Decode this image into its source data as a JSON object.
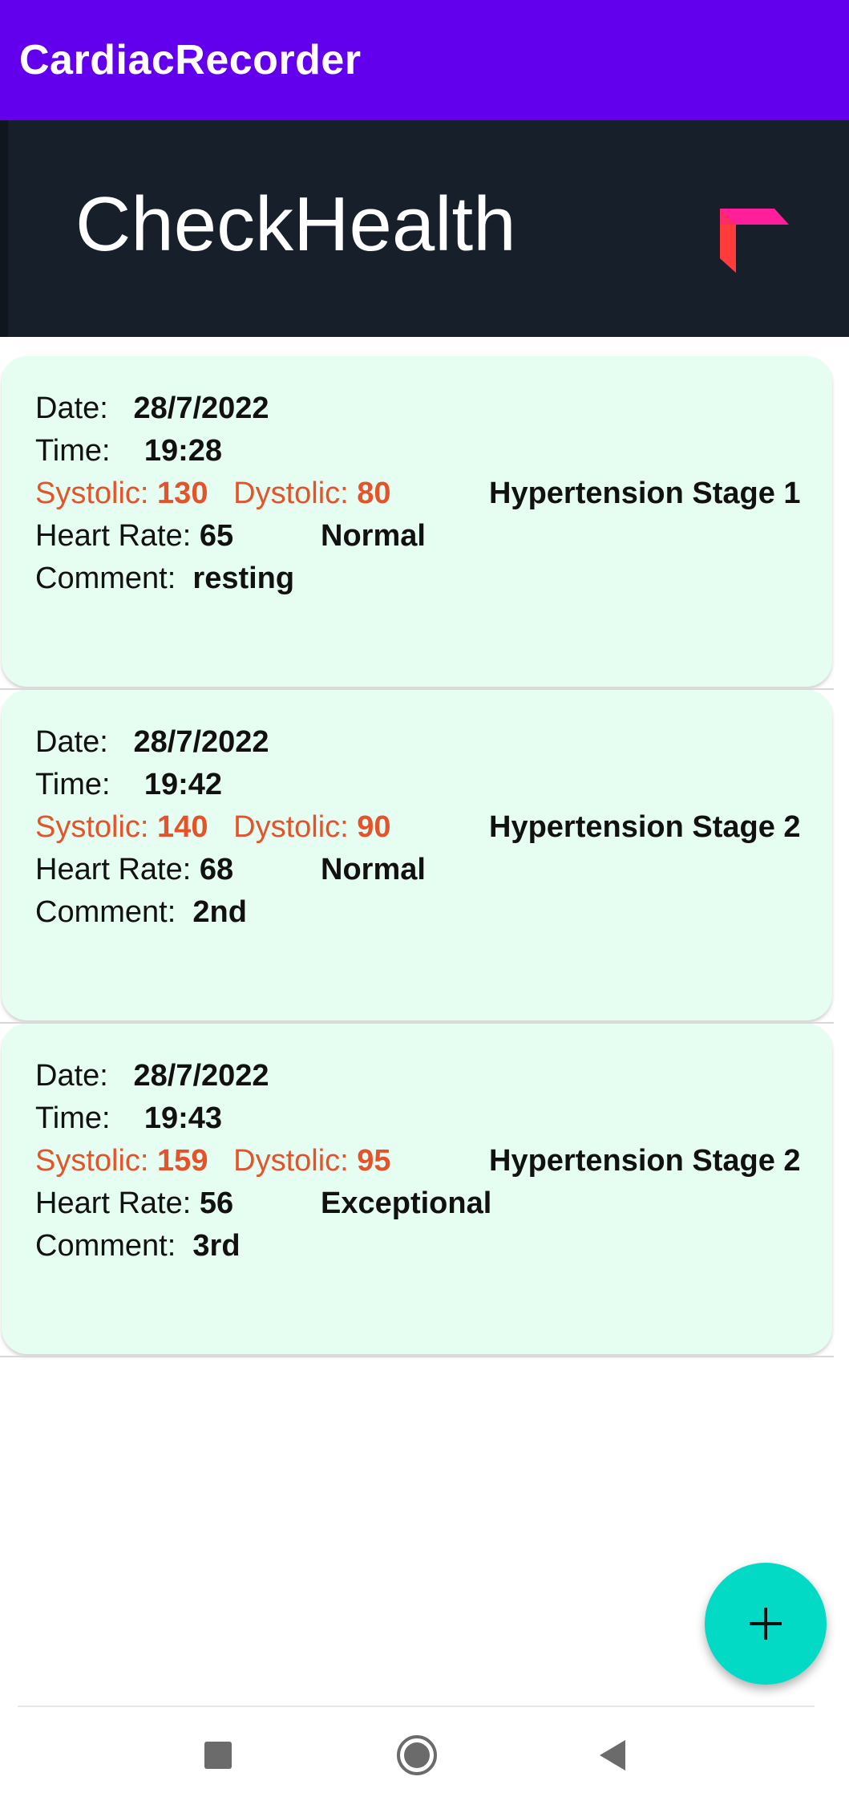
{
  "app_bar": {
    "title": "CardiacRecorder"
  },
  "banner": {
    "title": "CheckHealth",
    "logo_icon": "health-logo-icon"
  },
  "labels": {
    "date": "Date:",
    "time": "Time:",
    "systolic": "Systolic:",
    "dystolic": "Dystolic:",
    "heart_rate": "Heart Rate:",
    "comment": "Comment:"
  },
  "records": [
    {
      "date": "28/7/2022",
      "time": "19:28",
      "systolic": "130",
      "dystolic": "80",
      "pressure_status": "Hypertension Stage 1",
      "heart_rate": "65",
      "heart_status": "Normal",
      "comment": "resting"
    },
    {
      "date": "28/7/2022",
      "time": "19:42",
      "systolic": "140",
      "dystolic": "90",
      "pressure_status": "Hypertension Stage 2",
      "heart_rate": "68",
      "heart_status": "Normal",
      "comment": "2nd"
    },
    {
      "date": "28/7/2022",
      "time": "19:43",
      "systolic": "159",
      "dystolic": "95",
      "pressure_status": "Hypertension Stage 2",
      "heart_rate": "56",
      "heart_status": "Exceptional",
      "comment": "3rd"
    }
  ],
  "fab": {
    "icon": "plus-icon"
  },
  "nav": {
    "recents_icon": "square-icon",
    "home_icon": "circle-icon",
    "back_icon": "triangle-back-icon"
  },
  "colors": {
    "app_bar": "#6200ee",
    "banner": "#17202a",
    "card": "#e6fdf2",
    "accent_orange": "#e5532a",
    "fab": "#03dac5"
  }
}
